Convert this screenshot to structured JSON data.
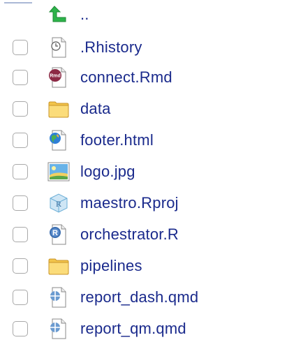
{
  "files": [
    {
      "name": "..",
      "icon": "up-arrow-icon",
      "checkbox": false
    },
    {
      "name": ".Rhistory",
      "icon": "history-file-icon",
      "checkbox": true
    },
    {
      "name": "connect.Rmd",
      "icon": "rmd-file-icon",
      "checkbox": true
    },
    {
      "name": "data",
      "icon": "folder-icon",
      "checkbox": true
    },
    {
      "name": "footer.html",
      "icon": "html-file-icon",
      "checkbox": true
    },
    {
      "name": "logo.jpg",
      "icon": "image-file-icon",
      "checkbox": true
    },
    {
      "name": "maestro.Rproj",
      "icon": "rproj-file-icon",
      "checkbox": true
    },
    {
      "name": "orchestrator.R",
      "icon": "r-file-icon",
      "checkbox": true
    },
    {
      "name": "pipelines",
      "icon": "folder-icon",
      "checkbox": true
    },
    {
      "name": "report_dash.qmd",
      "icon": "qmd-file-icon",
      "checkbox": true
    },
    {
      "name": "report_qm.qmd",
      "icon": "qmd-file-icon",
      "checkbox": true
    }
  ],
  "colors": {
    "link_text": "#1a2a8c",
    "checkbox_border": "#a9a9a9"
  }
}
